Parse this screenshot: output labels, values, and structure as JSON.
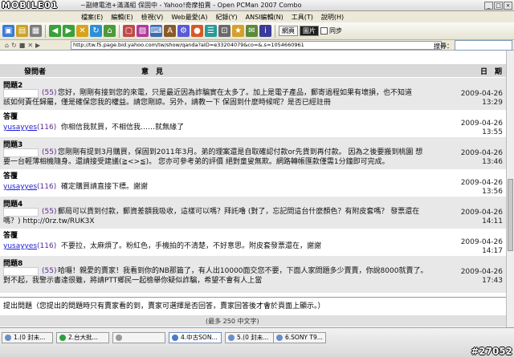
{
  "window": {
    "logo": "MOBILE01",
    "title": "~副總電池+滿滿組 保固中 - Yahoo!奇摩拍賣 - Open PCMan 2007 Combo",
    "controls": [
      "_",
      "□",
      "×"
    ]
  },
  "menu": [
    "檔案(E)",
    "編輯(E)",
    "檢視(V)",
    "Web最愛(A)",
    "紀錄(Y)",
    "ANSI編輯(N)",
    "工具(T)",
    "說明(H)"
  ],
  "toolbar": {
    "btn_web": "網頁",
    "btn_images": "圖片",
    "chk_pinned": "同步",
    "search_label": "搜尋："
  },
  "address": {
    "url": "http://tw.f5.page.bid.yahoo.com/tw/show/qanda?aID=e33204079&co=&.s=1054660961"
  },
  "table_header": {
    "asker": "發問者",
    "opinion": "意　見",
    "date": "日　期"
  },
  "questions": [
    {
      "label": "問題2",
      "score": "(55)",
      "text_l1": "您好，剛剛有接到您的來電，只是最近因為詐騙實在太多了。加上是電子產品，郵寄過程如果有壞損，也不知道",
      "text_l2": "該如何責任歸屬，僅是確保您我的權益。請您剛諒。另外，請教一下 保固到什麼時候呢？是否已經註冊",
      "date_d": "2009-04-26",
      "date_t": "13:29",
      "answer_label": "答覆",
      "responder": "yusayyes",
      "responder_score": "(116)",
      "answer": "你相信我就買，不相信我……就無緣了",
      "answer_date_d": "2009-04-26",
      "answer_date_t": "13:55"
    },
    {
      "label": "問題3",
      "score": "(55)",
      "text_l1": "您剛剛有提到3月購買，保固到2011年3月。弟的理案還是自取確認付款or先貨到再付款。 因為之後要搬到桃園 想",
      "text_l2": "要一台輕薄相機隨身。還請接受建議(≧<>≦)。 您亦可參考弟的評價 絕對童叟無欺。網路轉帳匯款僅需1分鐘即可完成。",
      "date_d": "2009-04-26",
      "date_t": "13:46",
      "answer_label": "答覆",
      "responder": "yusayyes",
      "responder_score": "(116)",
      "answer": "確定購買請直接下標。謝謝",
      "answer_date_d": "2009-04-26",
      "answer_date_t": "13:56"
    },
    {
      "label": "問題4",
      "score": "(55)",
      "text_l1": "郵局可以貨到付款，郵資差額我吸收，這樣可以嗎？拜託嚕 (對了，忘記問這台什麼顏色？有附皮套嗎？ 發票還在",
      "text_l2": "嗎？) http://0rz.tw/RUK3X",
      "date_d": "2009-04-26",
      "date_t": "14:11",
      "answer_label": "答覆",
      "responder": "yusayyes",
      "responder_score": "(116)",
      "answer": "不要拉，太麻煩了。粉紅色，手機拍的不清楚，不好意思。附皮套發票還在，謝謝",
      "answer_date_d": "2009-04-26",
      "answer_date_t": "14:17"
    },
    {
      "label": "問題8",
      "score": "(55)",
      "text_l1": "哈囉！親愛的賣家！我看到你的NB那篇了，有人出10000面交您不要，下面人家問題多少賣賣，你說8000就賣了。",
      "text_l2": "對不起，我警示書達很雖，將請PTT鄉民一起檢舉你疑似詐騙，希望不會有人上當",
      "date_d": "2009-04-26",
      "date_t": "17:43"
    }
  ],
  "footer": {
    "note": "提出問題（您提出的問題時只有賣家看的到，賣家可選擇是否回答，賣家回答後才會於頁面上顯示。）",
    "max": "(最多 250 中文字)"
  },
  "taskbar": {
    "items": [
      "1.(0 封未...",
      "2.台大批...",
      "",
      "4.中古SON...",
      "5.(0 封未...",
      "6.SONY T9..."
    ],
    "watermark": "#27052"
  }
}
